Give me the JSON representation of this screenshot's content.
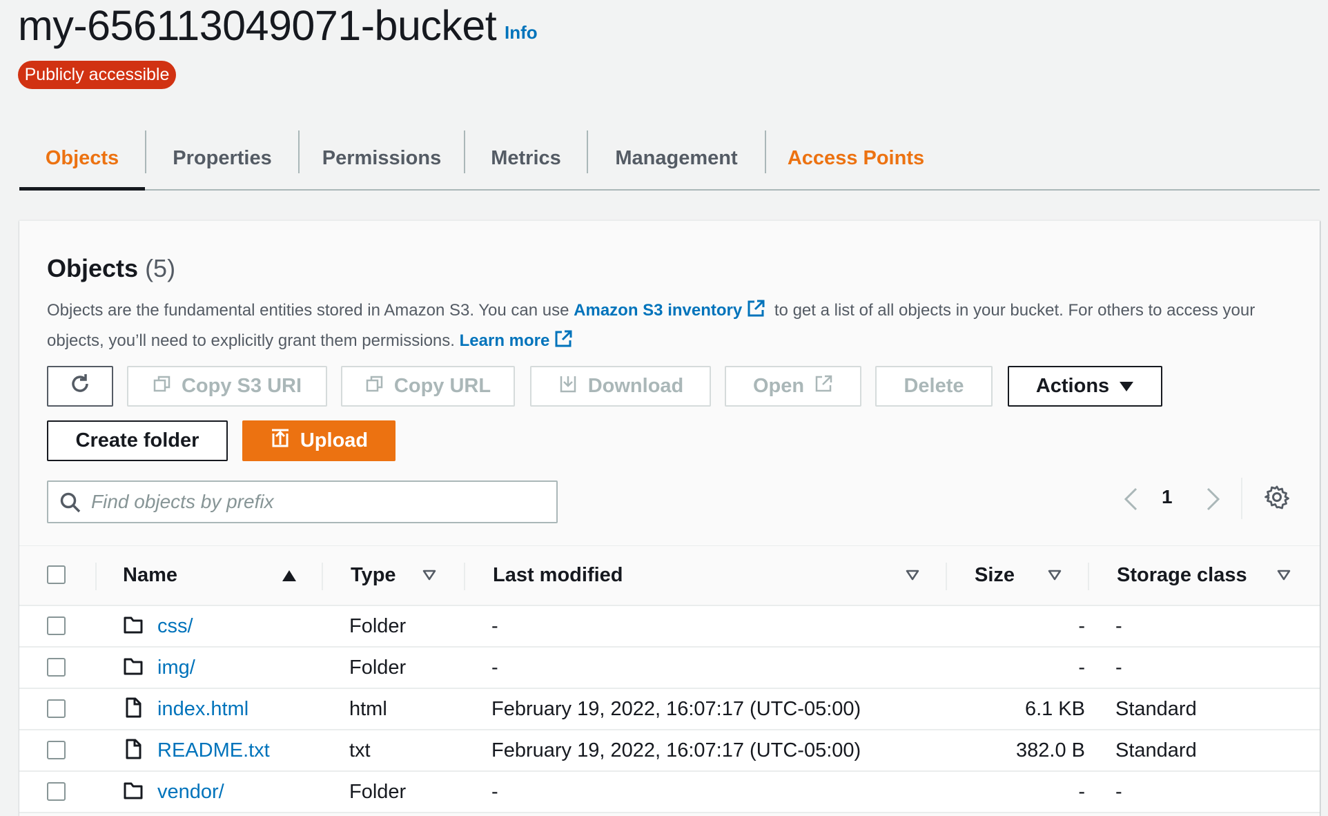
{
  "header": {
    "bucket_name": "my-656113049071-bucket",
    "info_label": "Info",
    "access_badge": "Publicly accessible"
  },
  "tabs": [
    {
      "label": "Objects",
      "active": true
    },
    {
      "label": "Properties"
    },
    {
      "label": "Permissions"
    },
    {
      "label": "Metrics"
    },
    {
      "label": "Management"
    },
    {
      "label": "Access Points"
    }
  ],
  "objects_panel": {
    "title": "Objects",
    "count": "(5)",
    "desc_part1": "Objects are the fundamental entities stored in Amazon S3. You can use",
    "desc_link1": "Amazon S3 inventory",
    "desc_part2": "to get a list of all objects in your bucket. For others to access your objects, you’ll need to explicitly grant them permissions.",
    "desc_link2": "Learn more"
  },
  "toolbar": {
    "refresh_icon": "refresh-icon",
    "copy_s3_uri": "Copy S3 URI",
    "copy_url": "Copy URL",
    "download": "Download",
    "open": "Open",
    "delete": "Delete",
    "actions": "Actions",
    "create_folder": "Create folder",
    "upload": "Upload"
  },
  "search": {
    "placeholder": "Find objects by prefix",
    "value": ""
  },
  "pagination": {
    "current_page": "1"
  },
  "table": {
    "columns": {
      "name": "Name",
      "type": "Type",
      "last_modified": "Last modified",
      "size": "Size",
      "storage_class": "Storage class"
    },
    "rows": [
      {
        "icon": "folder-icon",
        "name": "css/",
        "type": "Folder",
        "last_modified": "-",
        "size": "-",
        "storage_class": "-"
      },
      {
        "icon": "folder-icon",
        "name": "img/",
        "type": "Folder",
        "last_modified": "-",
        "size": "-",
        "storage_class": "-"
      },
      {
        "icon": "file-icon",
        "name": "index.html",
        "type": "html",
        "last_modified": "February 19, 2022, 16:07:17 (UTC-05:00)",
        "size": "6.1 KB",
        "storage_class": "Standard"
      },
      {
        "icon": "file-icon",
        "name": "README.txt",
        "type": "txt",
        "last_modified": "February 19, 2022, 16:07:17 (UTC-05:00)",
        "size": "382.0 B",
        "storage_class": "Standard"
      },
      {
        "icon": "folder-icon",
        "name": "vendor/",
        "type": "Folder",
        "last_modified": "-",
        "size": "-",
        "storage_class": "-"
      }
    ]
  },
  "colors": {
    "accent": "#ec7211",
    "link": "#0073bb",
    "danger_badge": "#d13212",
    "text": "#16191f"
  }
}
